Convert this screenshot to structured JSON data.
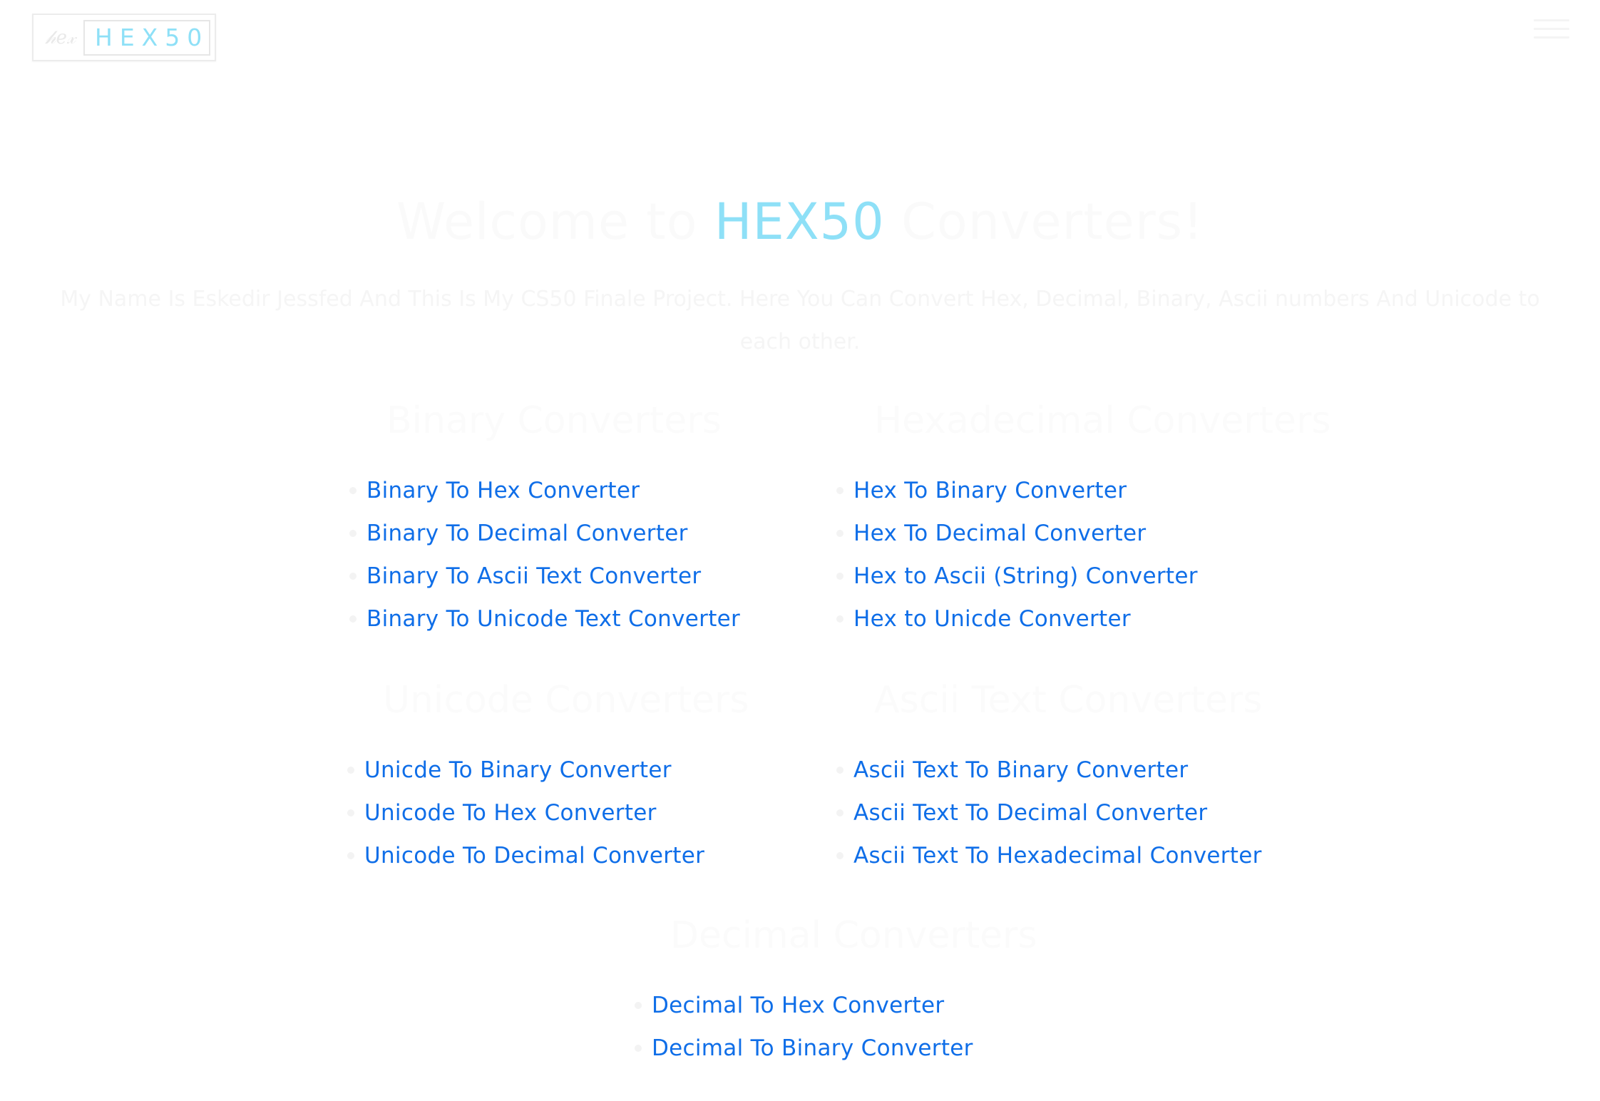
{
  "header": {
    "logo_mark": "𝒽𝑒𝓍",
    "logo_text": "HEX50"
  },
  "hero": {
    "title_pre": "Welcome to ",
    "title_brand": "HEX50",
    "title_post": " Converters!",
    "subtitle": "My Name Is Eskedir Jessfed And This Is My CS50 Finale Project. Here You Can Convert Hex, Decimal, Binary, Ascii numbers And Unicode to each other."
  },
  "sections": {
    "binary": {
      "title": "Binary Converters",
      "links": [
        "Binary To Hex Converter",
        "Binary To Decimal Converter",
        "Binary To Ascii Text Converter",
        "Binary To Unicode Text Converter"
      ]
    },
    "hex": {
      "title": "Hexadecimal Converters",
      "links": [
        "Hex To Binary Converter",
        "Hex To Decimal Converter",
        "Hex to Ascii (String) Converter",
        "Hex to Unicde Converter"
      ]
    },
    "unicode": {
      "title": "Unicode Converters",
      "links": [
        "Unicde To Binary Converter",
        "Unicode To Hex Converter",
        "Unicode To Decimal Converter"
      ]
    },
    "ascii": {
      "title": "Ascii Text Converters",
      "links": [
        "Ascii Text To Binary Converter",
        "Ascii Text To Decimal Converter",
        "Ascii Text To Hexadecimal Converter"
      ]
    },
    "decimal": {
      "title": "Decimal Converters",
      "links": [
        "Decimal To Hex Converter",
        "Decimal To Binary Converter"
      ]
    }
  },
  "colors": {
    "link": "#0f6ee8",
    "brand_cyan": "#8ee0f7",
    "faded_text": "#f8f8f8"
  }
}
